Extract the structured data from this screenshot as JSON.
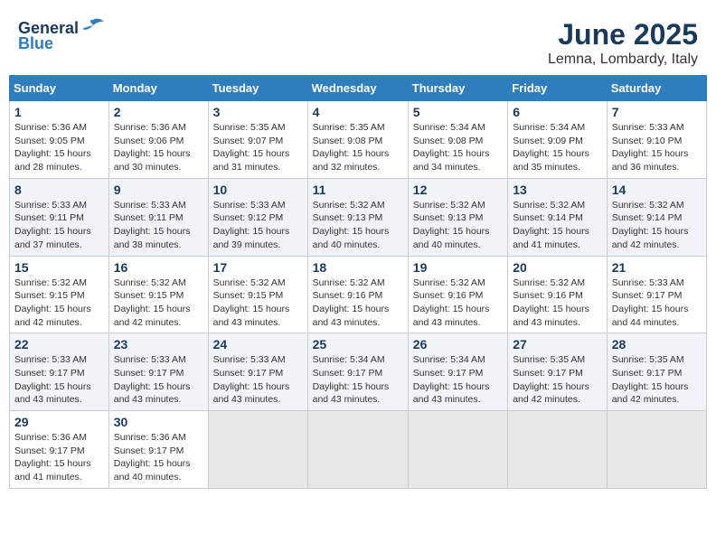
{
  "logo": {
    "general": "General",
    "blue": "Blue"
  },
  "title": "June 2025",
  "location": "Lemna, Lombardy, Italy",
  "weekdays": [
    "Sunday",
    "Monday",
    "Tuesday",
    "Wednesday",
    "Thursday",
    "Friday",
    "Saturday"
  ],
  "weeks": [
    [
      {
        "day": "1",
        "info": "Sunrise: 5:36 AM\nSunset: 9:05 PM\nDaylight: 15 hours\nand 28 minutes."
      },
      {
        "day": "2",
        "info": "Sunrise: 5:36 AM\nSunset: 9:06 PM\nDaylight: 15 hours\nand 30 minutes."
      },
      {
        "day": "3",
        "info": "Sunrise: 5:35 AM\nSunset: 9:07 PM\nDaylight: 15 hours\nand 31 minutes."
      },
      {
        "day": "4",
        "info": "Sunrise: 5:35 AM\nSunset: 9:08 PM\nDaylight: 15 hours\nand 32 minutes."
      },
      {
        "day": "5",
        "info": "Sunrise: 5:34 AM\nSunset: 9:08 PM\nDaylight: 15 hours\nand 34 minutes."
      },
      {
        "day": "6",
        "info": "Sunrise: 5:34 AM\nSunset: 9:09 PM\nDaylight: 15 hours\nand 35 minutes."
      },
      {
        "day": "7",
        "info": "Sunrise: 5:33 AM\nSunset: 9:10 PM\nDaylight: 15 hours\nand 36 minutes."
      }
    ],
    [
      {
        "day": "8",
        "info": "Sunrise: 5:33 AM\nSunset: 9:11 PM\nDaylight: 15 hours\nand 37 minutes."
      },
      {
        "day": "9",
        "info": "Sunrise: 5:33 AM\nSunset: 9:11 PM\nDaylight: 15 hours\nand 38 minutes."
      },
      {
        "day": "10",
        "info": "Sunrise: 5:33 AM\nSunset: 9:12 PM\nDaylight: 15 hours\nand 39 minutes."
      },
      {
        "day": "11",
        "info": "Sunrise: 5:32 AM\nSunset: 9:13 PM\nDaylight: 15 hours\nand 40 minutes."
      },
      {
        "day": "12",
        "info": "Sunrise: 5:32 AM\nSunset: 9:13 PM\nDaylight: 15 hours\nand 40 minutes."
      },
      {
        "day": "13",
        "info": "Sunrise: 5:32 AM\nSunset: 9:14 PM\nDaylight: 15 hours\nand 41 minutes."
      },
      {
        "day": "14",
        "info": "Sunrise: 5:32 AM\nSunset: 9:14 PM\nDaylight: 15 hours\nand 42 minutes."
      }
    ],
    [
      {
        "day": "15",
        "info": "Sunrise: 5:32 AM\nSunset: 9:15 PM\nDaylight: 15 hours\nand 42 minutes."
      },
      {
        "day": "16",
        "info": "Sunrise: 5:32 AM\nSunset: 9:15 PM\nDaylight: 15 hours\nand 42 minutes."
      },
      {
        "day": "17",
        "info": "Sunrise: 5:32 AM\nSunset: 9:15 PM\nDaylight: 15 hours\nand 43 minutes."
      },
      {
        "day": "18",
        "info": "Sunrise: 5:32 AM\nSunset: 9:16 PM\nDaylight: 15 hours\nand 43 minutes."
      },
      {
        "day": "19",
        "info": "Sunrise: 5:32 AM\nSunset: 9:16 PM\nDaylight: 15 hours\nand 43 minutes."
      },
      {
        "day": "20",
        "info": "Sunrise: 5:32 AM\nSunset: 9:16 PM\nDaylight: 15 hours\nand 43 minutes."
      },
      {
        "day": "21",
        "info": "Sunrise: 5:33 AM\nSunset: 9:17 PM\nDaylight: 15 hours\nand 44 minutes."
      }
    ],
    [
      {
        "day": "22",
        "info": "Sunrise: 5:33 AM\nSunset: 9:17 PM\nDaylight: 15 hours\nand 43 minutes."
      },
      {
        "day": "23",
        "info": "Sunrise: 5:33 AM\nSunset: 9:17 PM\nDaylight: 15 hours\nand 43 minutes."
      },
      {
        "day": "24",
        "info": "Sunrise: 5:33 AM\nSunset: 9:17 PM\nDaylight: 15 hours\nand 43 minutes."
      },
      {
        "day": "25",
        "info": "Sunrise: 5:34 AM\nSunset: 9:17 PM\nDaylight: 15 hours\nand 43 minutes."
      },
      {
        "day": "26",
        "info": "Sunrise: 5:34 AM\nSunset: 9:17 PM\nDaylight: 15 hours\nand 43 minutes."
      },
      {
        "day": "27",
        "info": "Sunrise: 5:35 AM\nSunset: 9:17 PM\nDaylight: 15 hours\nand 42 minutes."
      },
      {
        "day": "28",
        "info": "Sunrise: 5:35 AM\nSunset: 9:17 PM\nDaylight: 15 hours\nand 42 minutes."
      }
    ],
    [
      {
        "day": "29",
        "info": "Sunrise: 5:36 AM\nSunset: 9:17 PM\nDaylight: 15 hours\nand 41 minutes."
      },
      {
        "day": "30",
        "info": "Sunrise: 5:36 AM\nSunset: 9:17 PM\nDaylight: 15 hours\nand 40 minutes."
      },
      {
        "day": "",
        "info": ""
      },
      {
        "day": "",
        "info": ""
      },
      {
        "day": "",
        "info": ""
      },
      {
        "day": "",
        "info": ""
      },
      {
        "day": "",
        "info": ""
      }
    ]
  ]
}
